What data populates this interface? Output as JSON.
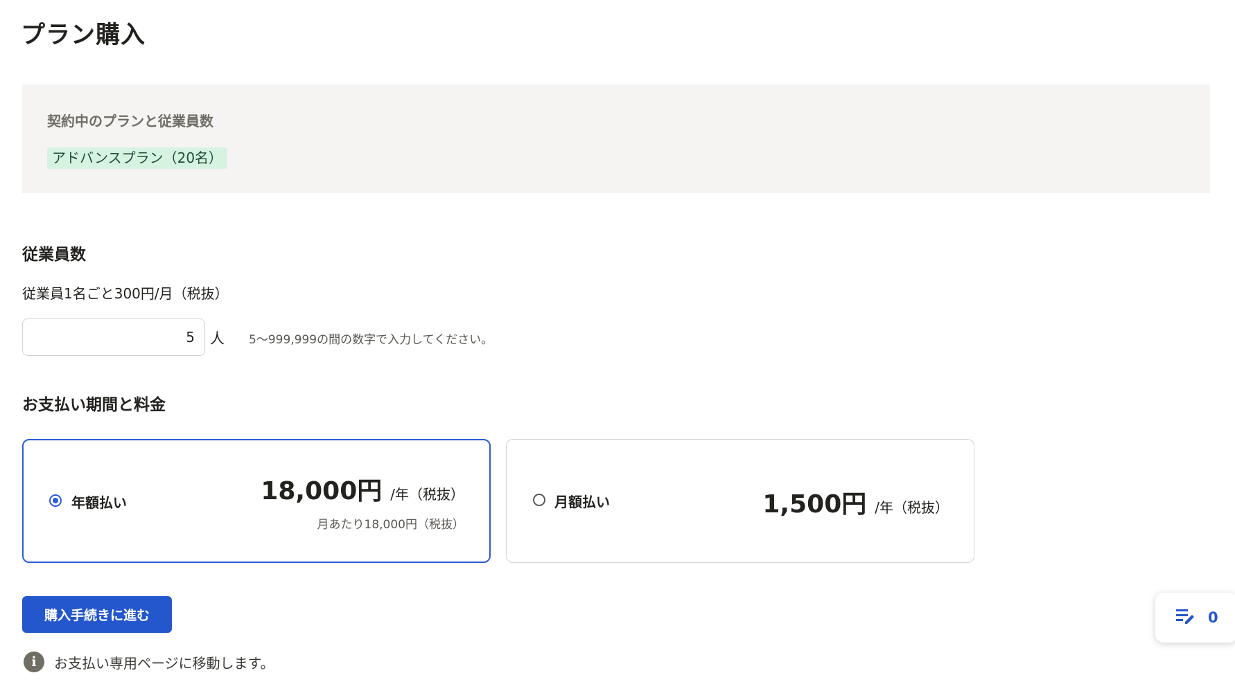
{
  "page": {
    "title": "プラン購入"
  },
  "current_plan": {
    "label": "契約中のプランと従業員数",
    "badge": "アドバンスプラン（20名）"
  },
  "employees": {
    "heading": "従業員数",
    "unit_price": "従業員1名ごと300円/月（税抜）",
    "count_value": "5",
    "unit": "人",
    "hint": "5〜999,999の間の数字で入力してください。"
  },
  "payment": {
    "heading": "お支払い期間と料金",
    "options": [
      {
        "name": "年額払い",
        "price": "18,000円",
        "period": "/年（税抜）",
        "sub": "月あたり18,000円（税抜）",
        "selected": true
      },
      {
        "name": "月額払い",
        "price": "1,500円",
        "period": "/年（税抜）",
        "selected": false
      }
    ]
  },
  "actions": {
    "proceed_label": "購入手続きに進む"
  },
  "notice": {
    "text": "お支払い専用ページに移動します。"
  },
  "widget": {
    "count": "0",
    "icon": "edit-list-icon"
  },
  "colors": {
    "accent": "#2456cc",
    "badge_bg": "#d6f3e2",
    "panel_bg": "#f5f4f3"
  }
}
